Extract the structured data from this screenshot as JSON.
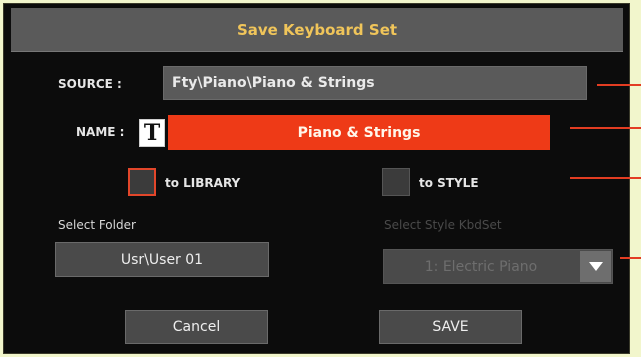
{
  "dialog": {
    "title": "Save Keyboard Set",
    "source_label": "SOURCE :",
    "source_value": "Fty\\Piano\\Piano & Strings",
    "name_label": "NAME :",
    "name_icon_glyph": "T",
    "name_value": "Piano & Strings",
    "to_library_label": "to LIBRARY",
    "to_library_checked": true,
    "to_style_label": "to STYLE",
    "to_style_checked": false,
    "select_folder_label": "Select Folder",
    "folder_value": "Usr\\User 01",
    "select_style_label": "Select Style KbdSet",
    "style_kbdset_value": "1: Electric Piano",
    "cancel_label": "Cancel",
    "save_label": "SAVE"
  },
  "colors": {
    "title_text": "#f0c55a",
    "accent": "#ee3a17",
    "background": "#0c0c0c",
    "frame": "#f2f6cc"
  },
  "icons": {
    "name_edit": "text-edit-icon",
    "dropdown": "chevron-down-icon"
  }
}
